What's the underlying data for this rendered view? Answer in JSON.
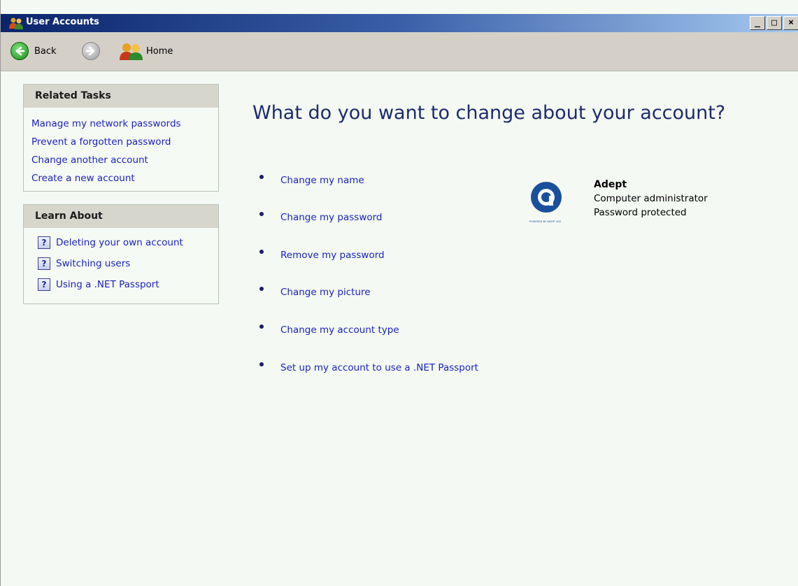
{
  "window": {
    "title": "User Accounts",
    "controls": {
      "minimize": "_",
      "maximize": "□",
      "close": "×"
    }
  },
  "toolbar": {
    "back_label": "Back",
    "home_label": "Home"
  },
  "related_tasks": {
    "heading": "Related Tasks",
    "items": [
      {
        "label": "Manage my network passwords"
      },
      {
        "label": "Prevent a forgotten password"
      },
      {
        "label": "Change another account"
      },
      {
        "label": "Create a new account"
      }
    ]
  },
  "learn_about": {
    "heading": "Learn About",
    "items": [
      {
        "label": "Deleting your own account",
        "icon": "help-icon"
      },
      {
        "label": "Switching users",
        "icon": "help-icon"
      },
      {
        "label": "Using a .NET Passport",
        "icon": "help-icon"
      }
    ]
  },
  "main": {
    "heading": "What do you want to change about your account?",
    "options": [
      {
        "label": "Change my name"
      },
      {
        "label": "Change my password"
      },
      {
        "label": "Remove my password"
      },
      {
        "label": "Change my picture"
      },
      {
        "label": "Change my account type"
      },
      {
        "label": "Set up my account to use a .NET Passport"
      }
    ]
  },
  "account": {
    "name": "Adept",
    "type": "Computer administrator",
    "status": "Password protected",
    "avatar_caption": "POWERED BY ADEPT ACE"
  },
  "colors": {
    "link": "#1a1fbd",
    "heading": "#1c2c6c",
    "titlebar_start": "#0a246a",
    "titlebar_end": "#a6caf0",
    "content_bg": "#f4f9f3"
  }
}
